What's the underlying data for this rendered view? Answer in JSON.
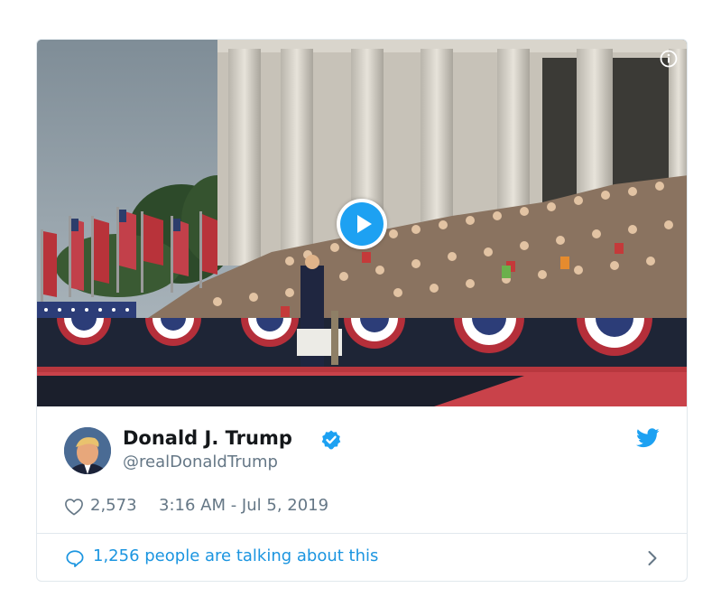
{
  "tweet": {
    "author_name": "Donald J. Trump",
    "author_handle": "@realDonaldTrump",
    "likes": "2,573",
    "timestamp": "3:16 AM - Jul 5, 2019",
    "talking": "1,256 people are talking about this"
  },
  "icons": {
    "info": "info-icon",
    "play": "play-icon",
    "verified": "verified-badge-icon",
    "bird": "twitter-bird-icon",
    "heart": "heart-icon",
    "bubble": "speech-bubble-icon",
    "chevron": "chevron-right-icon"
  },
  "colors": {
    "accent": "#1da1f2",
    "link": "#1b95e0",
    "secondary_text": "#657786",
    "primary_text": "#14171a",
    "border": "#e1e8ed"
  }
}
